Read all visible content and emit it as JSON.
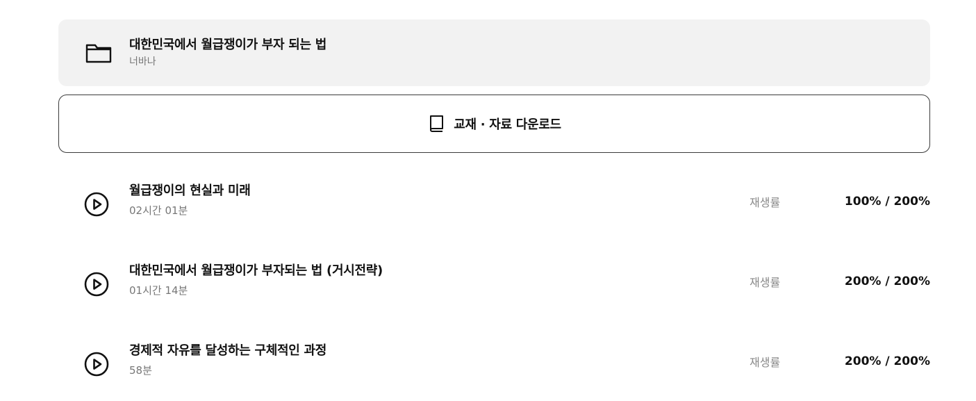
{
  "course": {
    "title": "대한민국에서 월급쟁이가 부자 되는 법",
    "author": "너바나"
  },
  "download": {
    "label": "교재 · 자료 다운로드"
  },
  "lessons": [
    {
      "title": "월급쟁이의 현실과 미래",
      "duration": "02시간 01분",
      "rate_label": "재생률",
      "rate_value": "100% / 200%"
    },
    {
      "title": "대한민국에서 월급쟁이가 부자되는 법 (거시전략)",
      "duration": "01시간 14분",
      "rate_label": "재생률",
      "rate_value": "200% / 200%"
    },
    {
      "title": "경제적 자유를 달성하는 구체적인 과정",
      "duration": "58분",
      "rate_label": "재생률",
      "rate_value": "200% / 200%"
    }
  ],
  "icons": {
    "folder": "folder-icon",
    "book": "book-icon",
    "play": "play-circle-icon"
  }
}
